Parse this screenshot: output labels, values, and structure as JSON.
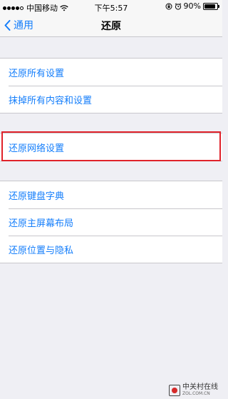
{
  "status_bar": {
    "carrier": "中国移动",
    "time": "下午5:57",
    "battery_percent": "90%",
    "battery_level": 0.9,
    "signal_bars_filled": 4,
    "signal_bars_total": 5
  },
  "nav": {
    "back_label": "通用",
    "title": "还原"
  },
  "groups": [
    {
      "items": [
        "还原所有设置",
        "抹掉所有内容和设置"
      ]
    },
    {
      "items": [
        "还原网络设置"
      ]
    },
    {
      "items": [
        "还原键盘字典",
        "还原主屏幕布局",
        "还原位置与隐私"
      ]
    }
  ],
  "colors": {
    "accent": "#147efb",
    "highlight_border": "#e0222a",
    "background": "#efeff4"
  },
  "watermark": {
    "name": "中关村在线",
    "url": "ZOL.COM.CN"
  }
}
